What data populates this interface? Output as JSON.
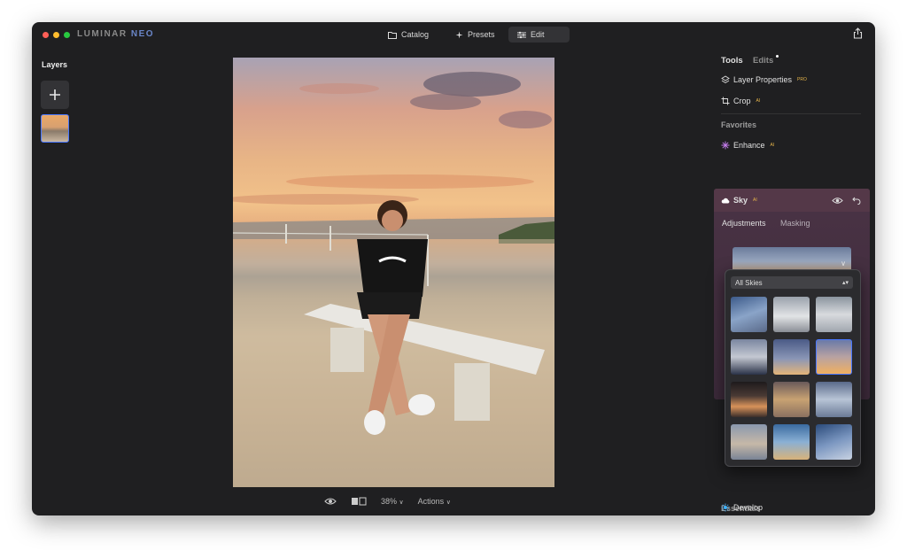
{
  "app": {
    "logo_left": "LUMINAR",
    "logo_right": "NEO"
  },
  "nav": {
    "catalog": "Catalog",
    "presets": "Presets",
    "edit": "Edit"
  },
  "layers": {
    "title": "Layers"
  },
  "bottom": {
    "zoom": "38%",
    "actions": "Actions"
  },
  "panel": {
    "tools_tab": "Tools",
    "edits_tab": "Edits",
    "layer_properties": "Layer Properties",
    "pro_badge": "PRO",
    "crop": "Crop",
    "ai_badge": "AI",
    "favorites": "Favorites",
    "enhance": "Enhance",
    "sky": "Sky",
    "adjustments_tab": "Adjustments",
    "masking_tab": "Masking",
    "essentials": "Essentials",
    "develop": "Develop"
  },
  "sky_popup": {
    "filter": "All Skies",
    "thumb_count": 12
  },
  "colors": {
    "accent_blue": "#4a78ff",
    "ai_badge": "#e8b64a",
    "sky_panel": "#4a3345"
  }
}
